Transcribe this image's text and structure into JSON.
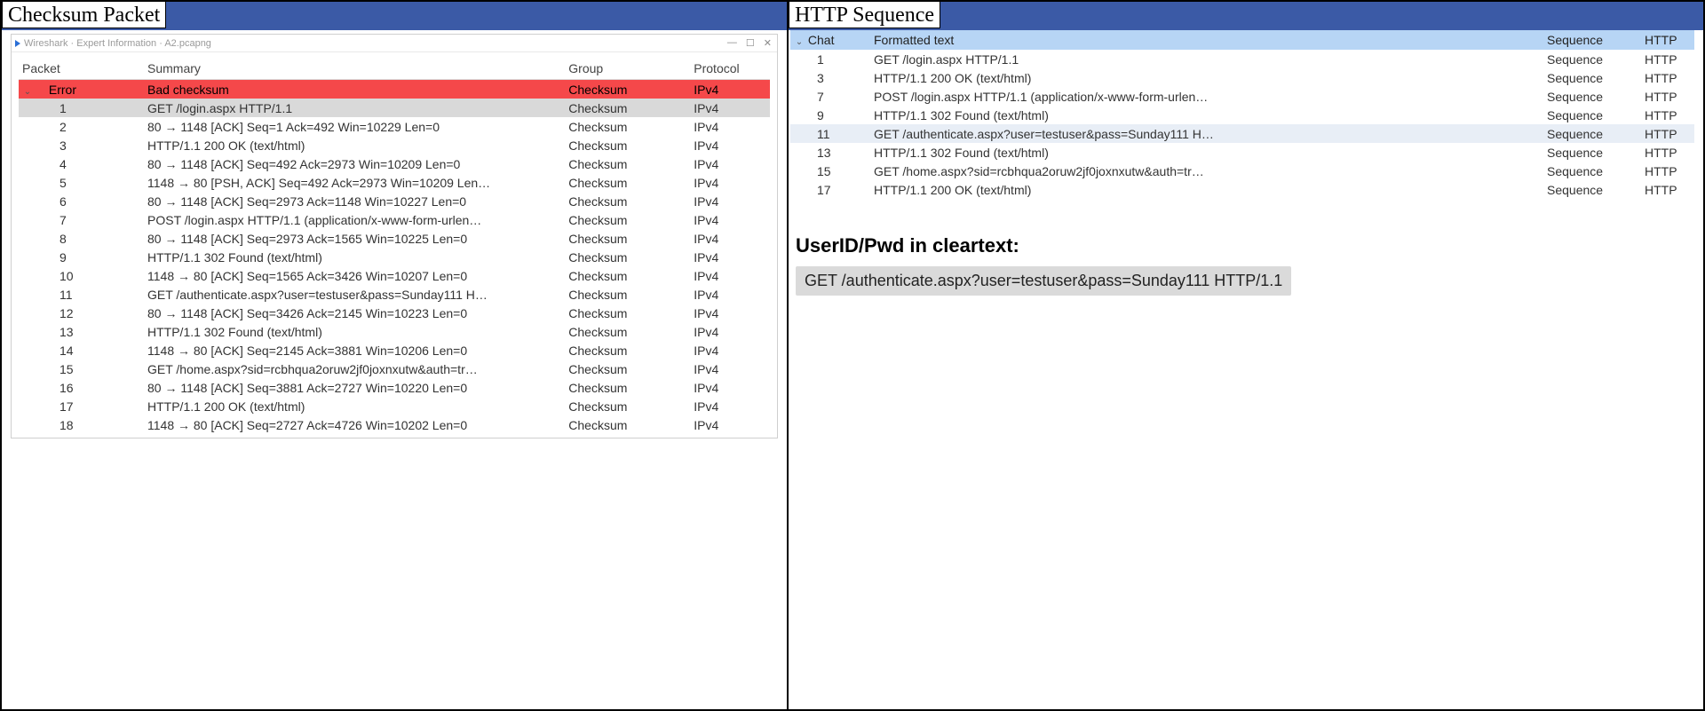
{
  "left": {
    "title": "Checksum Packet",
    "ws_title": "Wireshark · Expert Information · A2.pcapng",
    "ws_ctrl_min": "—",
    "ws_ctrl_max": "☐",
    "ws_ctrl_close": "✕",
    "columns": {
      "packet": "Packet",
      "summary": "Summary",
      "group": "Group",
      "protocol": "Protocol"
    },
    "expander": "⌄",
    "error_row": {
      "label": "Error",
      "summary": "Bad checksum",
      "group": "Checksum",
      "protocol": "IPv4"
    },
    "rows": [
      {
        "n": "1",
        "summary": "GET /login.aspx HTTP/1.1",
        "group": "Checksum",
        "protocol": "IPv4",
        "selected": true
      },
      {
        "n": "2",
        "summary": "80 → 1148 [ACK] Seq=1 Ack=492 Win=10229 Len=0",
        "group": "Checksum",
        "protocol": "IPv4"
      },
      {
        "n": "3",
        "summary": "HTTP/1.1 200 OK (text/html)",
        "group": "Checksum",
        "protocol": "IPv4"
      },
      {
        "n": "4",
        "summary": "80 → 1148 [ACK] Seq=492 Ack=2973 Win=10209 Len=0",
        "group": "Checksum",
        "protocol": "IPv4"
      },
      {
        "n": "5",
        "summary": "1148 → 80 [PSH, ACK] Seq=492 Ack=2973 Win=10209 Len…",
        "group": "Checksum",
        "protocol": "IPv4"
      },
      {
        "n": "6",
        "summary": "80 → 1148 [ACK] Seq=2973 Ack=1148 Win=10227 Len=0",
        "group": "Checksum",
        "protocol": "IPv4"
      },
      {
        "n": "7",
        "summary": "POST /login.aspx HTTP/1.1 (application/x-www-form-urlen…",
        "group": "Checksum",
        "protocol": "IPv4"
      },
      {
        "n": "8",
        "summary": "80 → 1148 [ACK] Seq=2973 Ack=1565 Win=10225 Len=0",
        "group": "Checksum",
        "protocol": "IPv4"
      },
      {
        "n": "9",
        "summary": "HTTP/1.1 302 Found (text/html)",
        "group": "Checksum",
        "protocol": "IPv4"
      },
      {
        "n": "10",
        "summary": "1148 → 80 [ACK] Seq=1565 Ack=3426 Win=10207 Len=0",
        "group": "Checksum",
        "protocol": "IPv4"
      },
      {
        "n": "11",
        "summary": "GET /authenticate.aspx?user=testuser&pass=Sunday111 H…",
        "group": "Checksum",
        "protocol": "IPv4"
      },
      {
        "n": "12",
        "summary": "80 → 1148 [ACK] Seq=3426 Ack=2145 Win=10223 Len=0",
        "group": "Checksum",
        "protocol": "IPv4"
      },
      {
        "n": "13",
        "summary": "HTTP/1.1 302 Found (text/html)",
        "group": "Checksum",
        "protocol": "IPv4"
      },
      {
        "n": "14",
        "summary": "1148 → 80 [ACK] Seq=2145 Ack=3881 Win=10206 Len=0",
        "group": "Checksum",
        "protocol": "IPv4"
      },
      {
        "n": "15",
        "summary": "GET /home.aspx?sid=rcbhqua2oruw2jf0joxnxutw&auth=tr…",
        "group": "Checksum",
        "protocol": "IPv4"
      },
      {
        "n": "16",
        "summary": "80 → 1148 [ACK] Seq=3881 Ack=2727 Win=10220 Len=0",
        "group": "Checksum",
        "protocol": "IPv4"
      },
      {
        "n": "17",
        "summary": "HTTP/1.1 200 OK (text/html)",
        "group": "Checksum",
        "protocol": "IPv4"
      },
      {
        "n": "18",
        "summary": "1148 → 80 [ACK] Seq=2727 Ack=4726 Win=10202 Len=0",
        "group": "Checksum",
        "protocol": "IPv4"
      }
    ]
  },
  "right": {
    "title": "HTTP Sequence",
    "columns": {
      "chat": "Chat",
      "ft": "Formatted text",
      "seq": "Sequence",
      "http": "HTTP"
    },
    "expander": "⌄",
    "rows": [
      {
        "n": "1",
        "ft": "GET /login.aspx HTTP/1.1",
        "seq": "Sequence",
        "http": "HTTP"
      },
      {
        "n": "3",
        "ft": "HTTP/1.1 200 OK (text/html)",
        "seq": "Sequence",
        "http": "HTTP"
      },
      {
        "n": "7",
        "ft": "POST /login.aspx HTTP/1.1 (application/x-www-form-urlen…",
        "seq": "Sequence",
        "http": "HTTP"
      },
      {
        "n": "9",
        "ft": "HTTP/1.1 302 Found (text/html)",
        "seq": "Sequence",
        "http": "HTTP"
      },
      {
        "n": "11",
        "ft": "GET /authenticate.aspx?user=testuser&pass=Sunday111 H…",
        "seq": "Sequence",
        "http": "HTTP",
        "selected": true
      },
      {
        "n": "13",
        "ft": "HTTP/1.1 302 Found (text/html)",
        "seq": "Sequence",
        "http": "HTTP"
      },
      {
        "n": "15",
        "ft": "GET /home.aspx?sid=rcbhqua2oruw2jf0joxnxutw&auth=tr…",
        "seq": "Sequence",
        "http": "HTTP"
      },
      {
        "n": "17",
        "ft": "HTTP/1.1 200 OK (text/html)",
        "seq": "Sequence",
        "http": "HTTP"
      }
    ],
    "cred_heading": "UserID/Pwd in cleartext:",
    "cred_text": "GET /authenticate.aspx?user=testuser&pass=Sunday111 HTTP/1.1"
  }
}
